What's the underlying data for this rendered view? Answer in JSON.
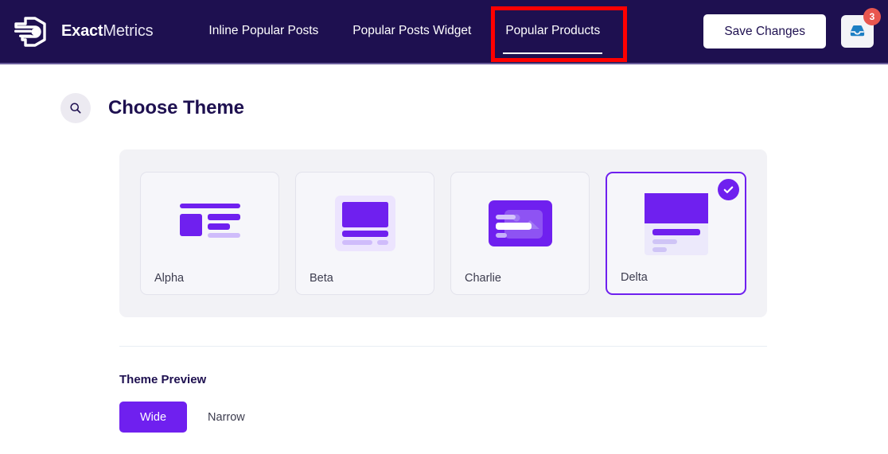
{
  "header": {
    "brand": {
      "logo_icon": "exactmetrics-hexagon-logo-icon",
      "name_bold": "Exact",
      "name_light": "Metrics"
    },
    "tabs": [
      {
        "label": "Inline Popular Posts",
        "active": false
      },
      {
        "label": "Popular Posts Widget",
        "active": false
      },
      {
        "label": "Popular Products",
        "active": true
      }
    ],
    "save_label": "Save Changes",
    "inbox_icon": "inbox-tray-icon",
    "inbox_badge": "3",
    "highlight_color": "#ff0000",
    "background_color": "#1e1050"
  },
  "section": {
    "search_icon": "search-icon",
    "title": "Choose Theme"
  },
  "themes": {
    "accent_color": "#6f20ef",
    "panel_background": "#f2f2f6",
    "selected_check_icon": "check-circle-icon",
    "items": [
      {
        "label": "Alpha",
        "thumb": "list-left-thumbnail-icon",
        "selected": false
      },
      {
        "label": "Beta",
        "thumb": "card-top-image-thumbnail-icon",
        "selected": false
      },
      {
        "label": "Charlie",
        "thumb": "overlay-card-thumbnail-icon",
        "selected": false
      },
      {
        "label": "Delta",
        "thumb": "image-above-text-thumbnail-icon",
        "selected": true
      }
    ]
  },
  "preview": {
    "title": "Theme Preview",
    "options": [
      {
        "label": "Wide",
        "active": true
      },
      {
        "label": "Narrow",
        "active": false
      }
    ]
  }
}
